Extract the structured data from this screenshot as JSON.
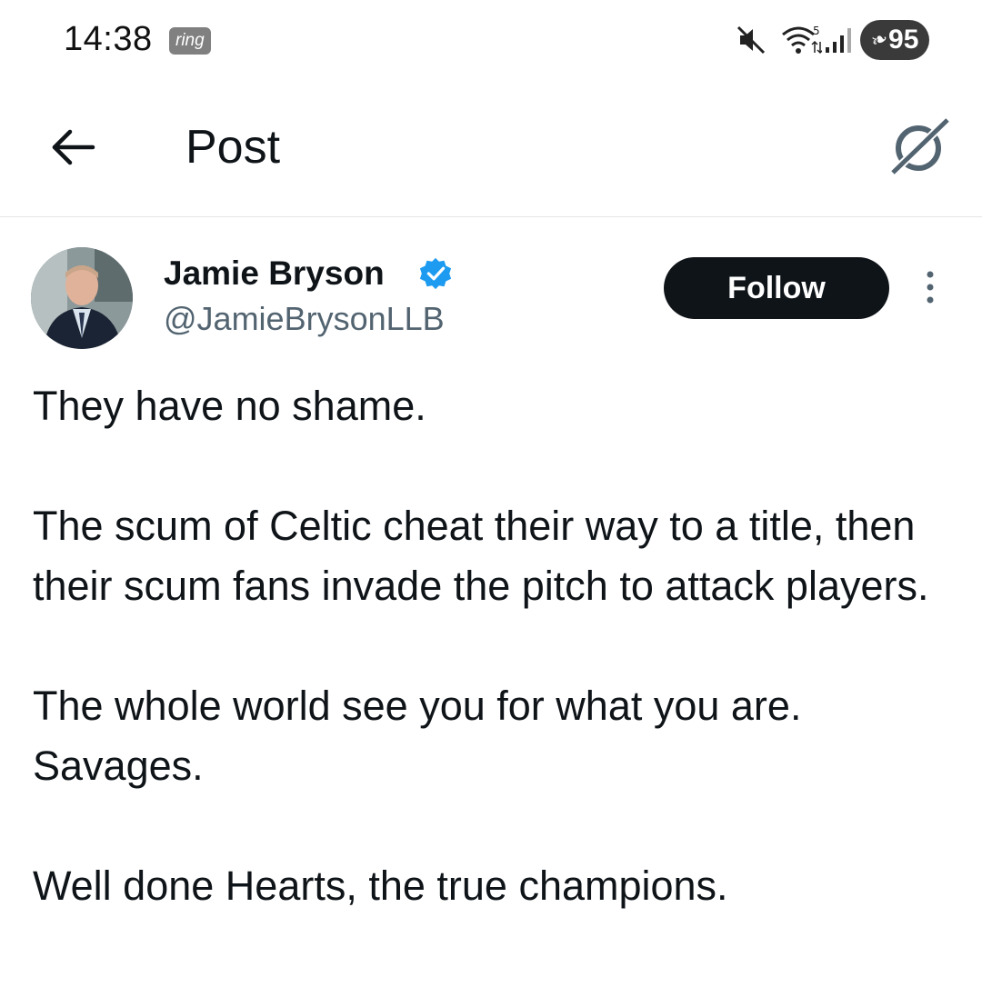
{
  "status_bar": {
    "time": "14:38",
    "notification_badge": "ring",
    "battery_level": "95",
    "icons": [
      "mute-icon",
      "wifi-icon",
      "signal-icon",
      "battery-icon"
    ]
  },
  "header": {
    "title": "Post",
    "back_icon": "back-arrow-icon",
    "grok_icon": "grok-icon"
  },
  "post": {
    "author": {
      "name": "Jamie Bryson",
      "handle": "@JamieBrysonLLB",
      "verified": true
    },
    "follow_label": "Follow",
    "paragraphs": [
      "They have no shame.",
      "The scum of Celtic cheat their way to a title, then their scum fans invade the pitch to attack players.",
      "The whole world see you for what you are. Savages.",
      "Well done Hearts, the true champions."
    ]
  },
  "colors": {
    "text": "#0f1419",
    "secondary_text": "#536471",
    "verified_blue": "#1d9bf0",
    "follow_bg": "#0f1419"
  }
}
